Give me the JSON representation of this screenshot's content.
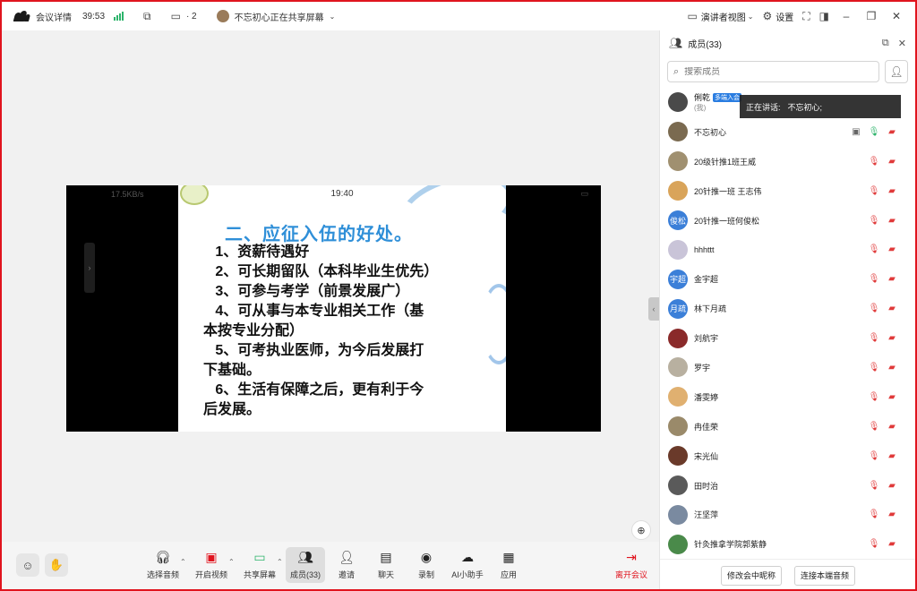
{
  "titlebar": {
    "meeting_info": "会议详情",
    "duration": "39:53",
    "device_count": "· 2",
    "sharer": "不忘初心正在共享屏幕",
    "presenter_view": "演讲者视图",
    "settings": "设置"
  },
  "video": {
    "phone_speed": "17.5KB/s",
    "phone_time": "19:40",
    "slide_title": "二、应征入伍的好处。",
    "slide_lines": [
      "   1、资薪待遇好",
      "   2、可长期留队（本科毕业生优先）",
      "   3、可参与考学（前景发展广）",
      "   4、可从事与本专业相关工作（基",
      "本按专业分配）",
      "   5、可考执业医师，为今后发展打",
      "下基础。",
      "   6、生活有保障之后，更有利于今",
      "后发展。"
    ]
  },
  "toolbar": {
    "audio": "选择音频",
    "video": "开启视频",
    "share": "共享屏幕",
    "members": "成员(33)",
    "invite": "邀请",
    "chat": "聊天",
    "record": "录制",
    "ai": "AI小助手",
    "apps": "应用",
    "leave": "离开会议"
  },
  "panel": {
    "title": "成员(33)",
    "search_placeholder": "搜索成员",
    "speaking_label": "正在讲话:",
    "speaking_name": "不忘初心;",
    "rename_button": "修改会中昵称",
    "connect_audio_button": "连接本端音频",
    "members": [
      {
        "name": "俐乾",
        "sub": "(我)",
        "tag": "多端入会",
        "avatar": "photo",
        "color": "#4a4a4a",
        "state": "self"
      },
      {
        "name": "不忘初心",
        "avatar": "photo",
        "color": "#7a6a50",
        "state": "sharing"
      },
      {
        "name": "20级针推1班王威",
        "avatar": "photo",
        "color": "#a09070",
        "state": "muted"
      },
      {
        "name": "20针推一班 王志伟",
        "avatar": "photo",
        "color": "#d9a45a",
        "state": "muted"
      },
      {
        "name": "20针推一班何俊松",
        "avatar": "text",
        "avatar_text": "俊松",
        "color": "#3b7fd8",
        "state": "muted"
      },
      {
        "name": "hhhttt",
        "avatar": "photo",
        "color": "#c9c4d8",
        "state": "muted"
      },
      {
        "name": "金宇超",
        "avatar": "text",
        "avatar_text": "宇超",
        "color": "#3b7fd8",
        "state": "muted"
      },
      {
        "name": "林下月疏",
        "avatar": "text",
        "avatar_text": "月疏",
        "color": "#3b7fd8",
        "state": "muted"
      },
      {
        "name": "刘航宇",
        "avatar": "photo",
        "color": "#8a2a2a",
        "state": "muted"
      },
      {
        "name": "罗宇",
        "avatar": "photo",
        "color": "#b8b0a0",
        "state": "muted"
      },
      {
        "name": "潘雯婷",
        "avatar": "photo",
        "color": "#e0b070",
        "state": "muted"
      },
      {
        "name": "冉佳荣",
        "avatar": "photo",
        "color": "#9a8a6a",
        "state": "muted"
      },
      {
        "name": "宋光仙",
        "avatar": "photo",
        "color": "#6a3a2a",
        "state": "muted"
      },
      {
        "name": "田时治",
        "avatar": "photo",
        "color": "#5a5a5a",
        "state": "muted"
      },
      {
        "name": "汪坚萍",
        "avatar": "photo",
        "color": "#7a8aa0",
        "state": "muted"
      },
      {
        "name": "针灸推拿学院郭紫静",
        "avatar": "photo",
        "color": "#4a8a4a",
        "state": "muted"
      }
    ]
  },
  "colors": {
    "accent": "#2a7de1",
    "danger": "#e0141e",
    "signal": "#2db46b",
    "slide_title": "#2f8fd8"
  }
}
